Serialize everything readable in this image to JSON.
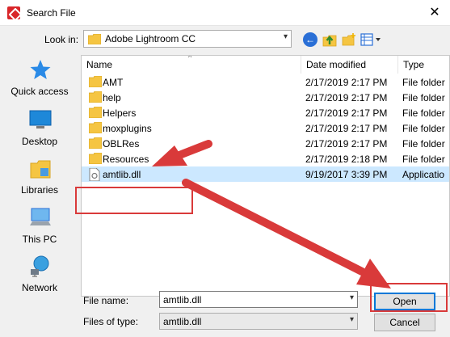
{
  "window": {
    "title": "Search File",
    "close_glyph": "✕"
  },
  "lookin": {
    "label": "Look in:",
    "value": "Adobe Lightroom CC",
    "chevron": "▾"
  },
  "toolbar": {
    "back": "back-icon",
    "up": "up-folder-icon",
    "new_folder": "new-folder-icon",
    "view": "view-menu-icon"
  },
  "places": [
    {
      "label": "Quick access",
      "icon": "star-icon"
    },
    {
      "label": "Desktop",
      "icon": "desktop-icon"
    },
    {
      "label": "Libraries",
      "icon": "libraries-icon"
    },
    {
      "label": "This PC",
      "icon": "computer-icon"
    },
    {
      "label": "Network",
      "icon": "network-icon"
    }
  ],
  "filelist": {
    "columns": [
      "Name",
      "Date modified",
      "Type"
    ],
    "sort_glyph": "^",
    "rows": [
      {
        "name": "AMT",
        "date": "2/17/2019 2:17 PM",
        "type": "File folder",
        "kind": "folder"
      },
      {
        "name": "help",
        "date": "2/17/2019 2:17 PM",
        "type": "File folder",
        "kind": "folder"
      },
      {
        "name": "Helpers",
        "date": "2/17/2019 2:17 PM",
        "type": "File folder",
        "kind": "folder"
      },
      {
        "name": "moxplugins",
        "date": "2/17/2019 2:17 PM",
        "type": "File folder",
        "kind": "folder"
      },
      {
        "name": "OBLRes",
        "date": "2/17/2019 2:17 PM",
        "type": "File folder",
        "kind": "folder"
      },
      {
        "name": "Resources",
        "date": "2/17/2019 2:18 PM",
        "type": "File folder",
        "kind": "folder"
      },
      {
        "name": "amtlib.dll",
        "date": "9/19/2017 3:39 PM",
        "type": "Applicatio",
        "kind": "dll",
        "selected": true
      }
    ]
  },
  "filename": {
    "label": "File name:",
    "value": "amtlib.dll",
    "chevron": "▾"
  },
  "filetype": {
    "label": "Files of type:",
    "value": "amtlib.dll",
    "chevron": "▾"
  },
  "buttons": {
    "open": "Open",
    "cancel": "Cancel"
  },
  "colors": {
    "annotation": "#d93a3a",
    "selection": "#cce8ff",
    "folder": "#f5c542"
  }
}
